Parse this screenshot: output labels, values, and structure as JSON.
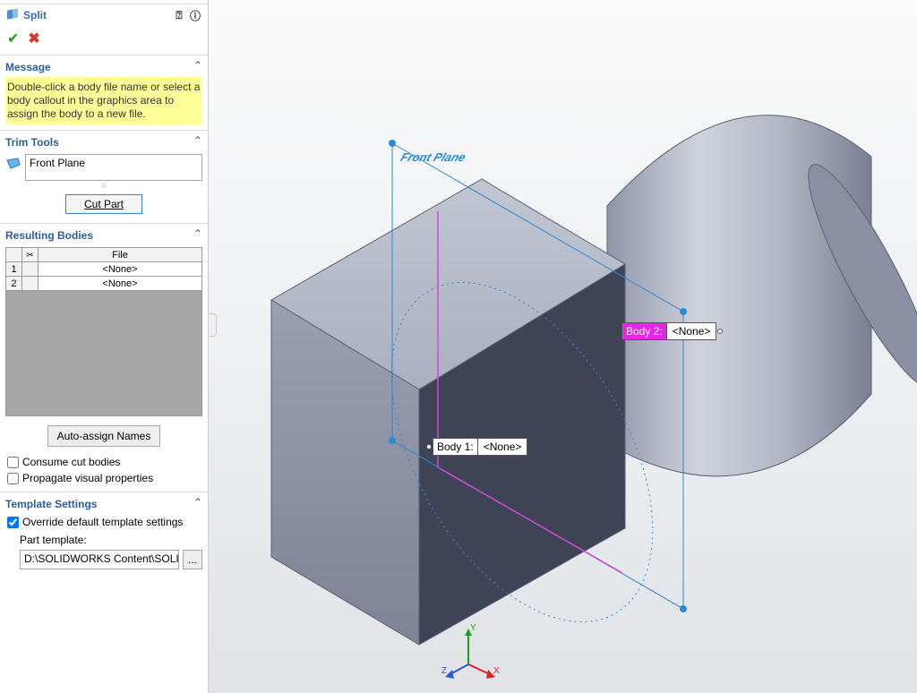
{
  "feature": {
    "title": "Split"
  },
  "sections": {
    "message": {
      "title": "Message",
      "body": "Double-click a body file name or select a body callout in the graphics area to assign the body to a new file."
    },
    "trim": {
      "title": "Trim Tools",
      "value": "Front Plane",
      "cut_button": "Cut Part"
    },
    "resulting": {
      "title": "Resulting Bodies",
      "col_file": "File",
      "rows": [
        {
          "n": "1",
          "file": "<None>"
        },
        {
          "n": "2",
          "file": "<None>"
        }
      ],
      "auto_assign": "Auto-assign Names",
      "consume": "Consume cut bodies",
      "propagate": "Propagate visual properties"
    },
    "template": {
      "title": "Template Settings",
      "override": "Override default template settings",
      "part_template_label": "Part template:",
      "path": "D:\\SOLIDWORKS Content\\SOLI",
      "browse": "..."
    }
  },
  "viewport": {
    "plane_label": "Front Plane",
    "callouts": [
      {
        "label": "Body 1:",
        "value": "<None>"
      },
      {
        "label": "Body 2:",
        "value": "<None>"
      }
    ],
    "triad": {
      "x": "X",
      "y": "Y",
      "z": "Z"
    }
  }
}
